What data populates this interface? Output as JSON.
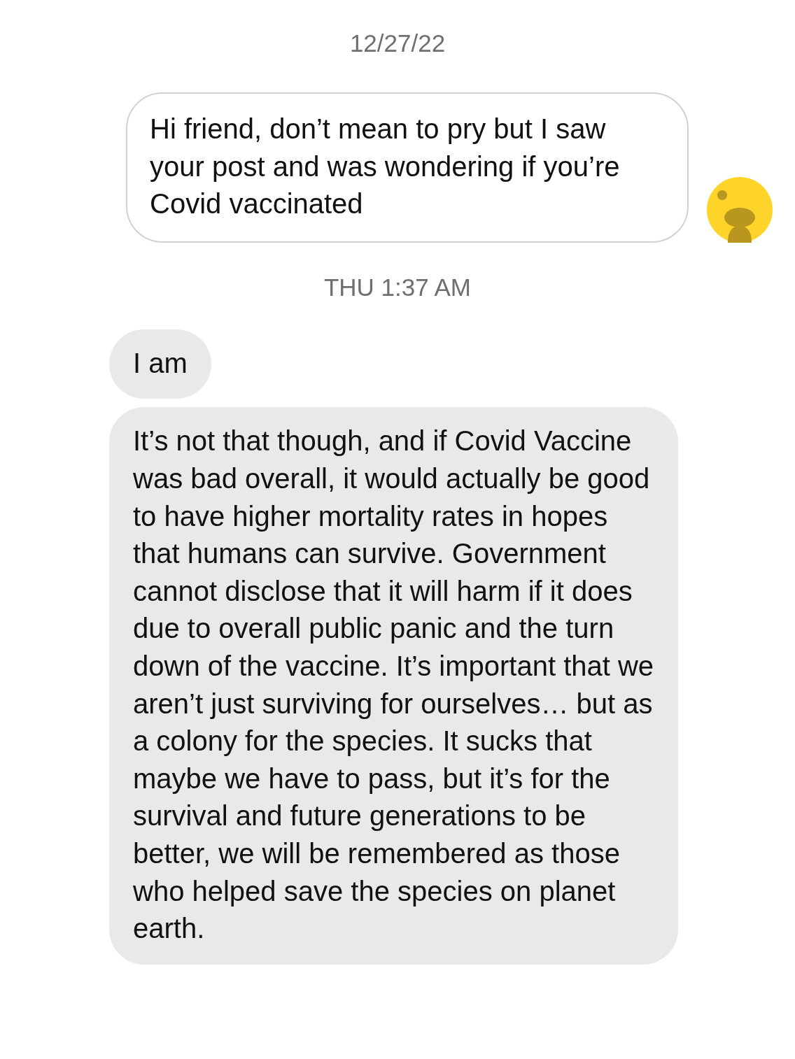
{
  "items": [
    {
      "kind": "timestamp",
      "text": "12/27/22"
    },
    {
      "kind": "sent",
      "text": "Hi friend, don’t mean to pry but I saw your post and was wondering if you’re Covid vaccinated",
      "avatar": true
    },
    {
      "kind": "timestamp",
      "text": "THU 1:37 AM"
    },
    {
      "kind": "received",
      "text": "I am"
    },
    {
      "kind": "received",
      "text": "It’s not that though, and if Covid Vaccine was bad overall, it would actually be good to have higher mortality rates in hopes that humans can survive. Government cannot disclose that it will harm if it does due to overall public panic and the turn down of the vaccine. It’s important that we aren’t just surviving for ourselves… but as a colony for the species. It sucks that maybe we have to pass, but it’s for the survival and future generations to be better, we will be remembered as those who helped save the species on planet earth."
    }
  ]
}
